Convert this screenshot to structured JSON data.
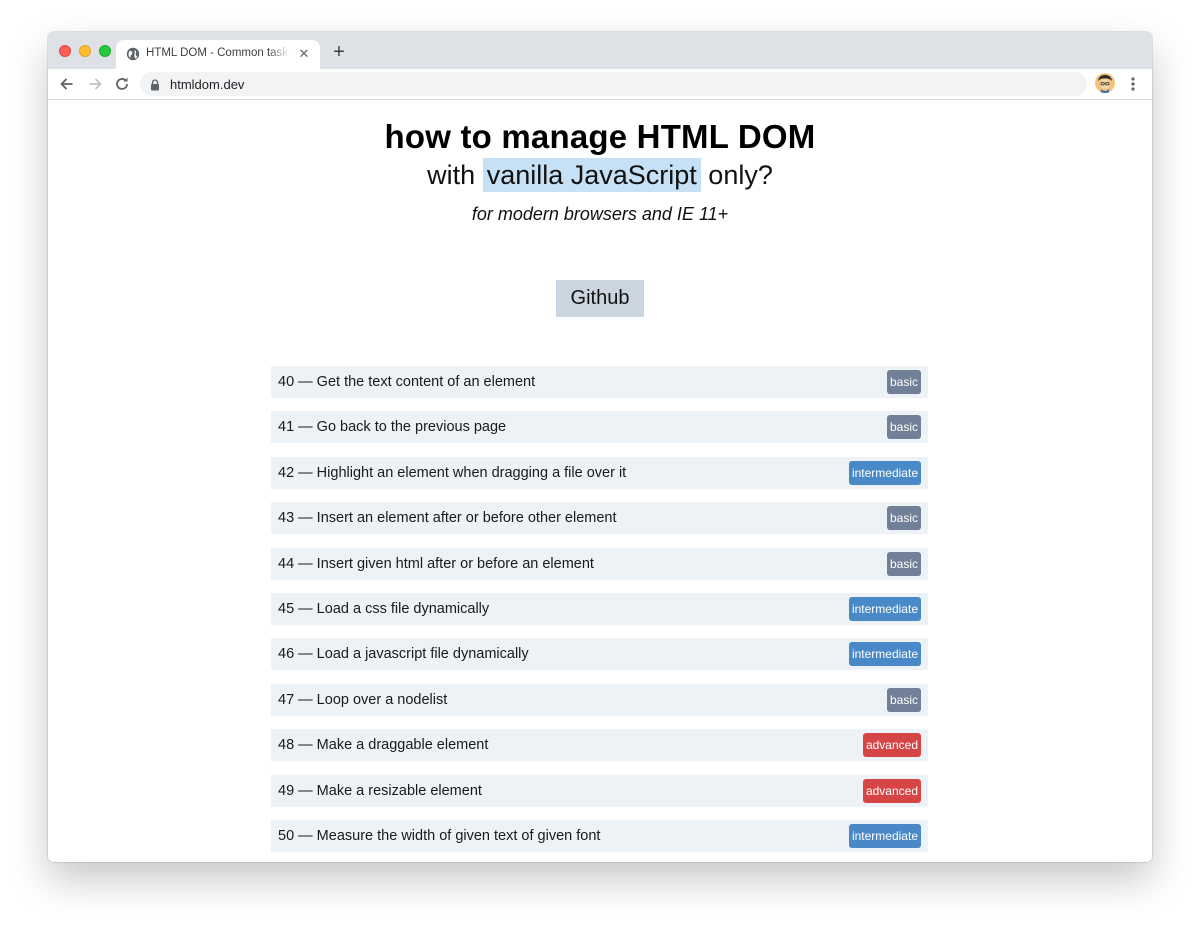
{
  "browser": {
    "tab_title": "HTML DOM - Common tasks of managing HTML DOM with vanilla JavaScript",
    "tab_close": "✕",
    "new_tab": "+",
    "url": "htmldom.dev"
  },
  "page": {
    "headline": "how to manage HTML DOM",
    "subhead_prefix": "with",
    "subhead_highlight": "vanilla JavaScript",
    "subhead_suffix": "only?",
    "tagline": "for modern browsers and IE 11+",
    "github_label": "Github"
  },
  "level_colors": {
    "basic": "#718096",
    "intermediate": "#4a89c8",
    "advanced": "#d64545"
  },
  "tasks": [
    {
      "title": "40 — Get the text content of an element",
      "level": "basic"
    },
    {
      "title": "41 — Go back to the previous page",
      "level": "basic"
    },
    {
      "title": "42 — Highlight an element when dragging a file over it",
      "level": "intermediate"
    },
    {
      "title": "43 — Insert an element after or before other element",
      "level": "basic"
    },
    {
      "title": "44 — Insert given html after or before an element",
      "level": "basic"
    },
    {
      "title": "45 — Load a css file dynamically",
      "level": "intermediate"
    },
    {
      "title": "46 — Load a javascript file dynamically",
      "level": "intermediate"
    },
    {
      "title": "47 — Loop over a nodelist",
      "level": "basic"
    },
    {
      "title": "48 — Make a draggable element",
      "level": "advanced"
    },
    {
      "title": "49 — Make a resizable element",
      "level": "advanced"
    },
    {
      "title": "50 — Measure the width of given text of given font",
      "level": "intermediate"
    }
  ]
}
